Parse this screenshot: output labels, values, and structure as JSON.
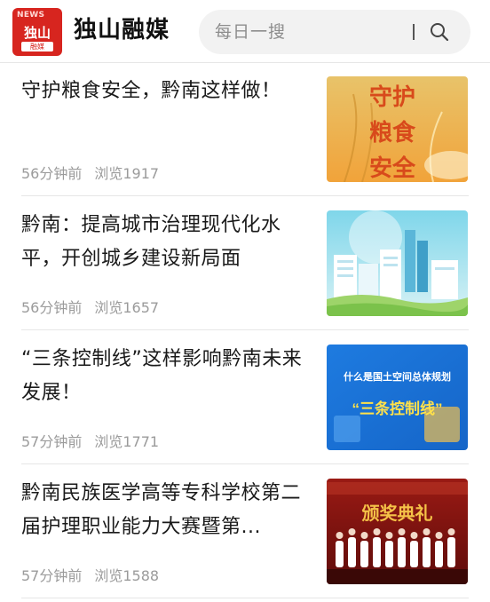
{
  "app": {
    "logo_en": "NEWS",
    "logo_cn": "独山",
    "logo_sub": "融媒",
    "title": "独山融媒"
  },
  "search": {
    "placeholder": "每日一搜",
    "icon": "search-icon"
  },
  "colors": {
    "brand_red": "#d7251f",
    "meta_gray": "#9b9b9b",
    "divider": "#e6e6e6"
  },
  "articles": [
    {
      "title": "守护粮食安全，黔南这样做！",
      "time": "56分钟前",
      "views": "浏览1917",
      "thumb_text": [
        "守护",
        "粮食",
        "安全"
      ]
    },
    {
      "title": "黔南：提高城市治理现代化水平，开创城乡建设新局面",
      "time": "56分钟前",
      "views": "浏览1657"
    },
    {
      "title": "“三条控制线”这样影响黔南未来发展！",
      "time": "57分钟前",
      "views": "浏览1771",
      "thumb_text": [
        "什么是国土空间总体规划",
        "“三条控制线”"
      ]
    },
    {
      "title": "黔南民族医学高等专科学校第二届护理职业能力大赛暨第...",
      "time": "57分钟前",
      "views": "浏览1588",
      "thumb_text": [
        "颁奖典礼"
      ]
    }
  ]
}
